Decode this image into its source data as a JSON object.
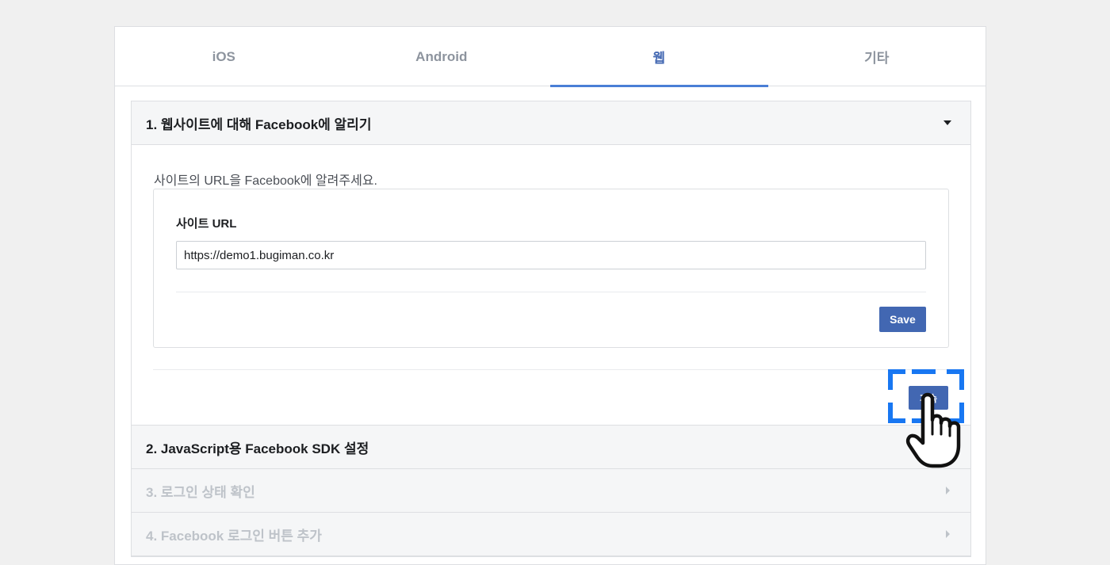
{
  "tabs": [
    {
      "label": "iOS",
      "active": false
    },
    {
      "label": "Android",
      "active": false
    },
    {
      "label": "웹",
      "active": true
    },
    {
      "label": "기타",
      "active": false
    }
  ],
  "steps": [
    {
      "title": "1. 웹사이트에 대해 Facebook에 알리기",
      "expanded": true,
      "enabled": true
    },
    {
      "title": "2. JavaScript용 Facebook SDK 설정",
      "expanded": false,
      "enabled": true
    },
    {
      "title": "3. 로그인 상태 확인",
      "expanded": false,
      "enabled": false
    },
    {
      "title": "4. Facebook 로그인 버튼 추가",
      "expanded": false,
      "enabled": false
    }
  ],
  "step1": {
    "intro": "사이트의 URL을 Facebook에 알려주세요.",
    "field_label": "사이트 URL",
    "url_value": "https://demo1.bugiman.co.kr",
    "save_label": "Save",
    "next_label": "계속"
  },
  "colors": {
    "accent": "#4267b2",
    "tab_underline": "#4a7fd6",
    "focus_frame": "#1877f2"
  },
  "icons": {
    "expanded": "caret-down-icon",
    "collapsed": "caret-right-icon",
    "cursor": "hand-pointer-icon"
  }
}
